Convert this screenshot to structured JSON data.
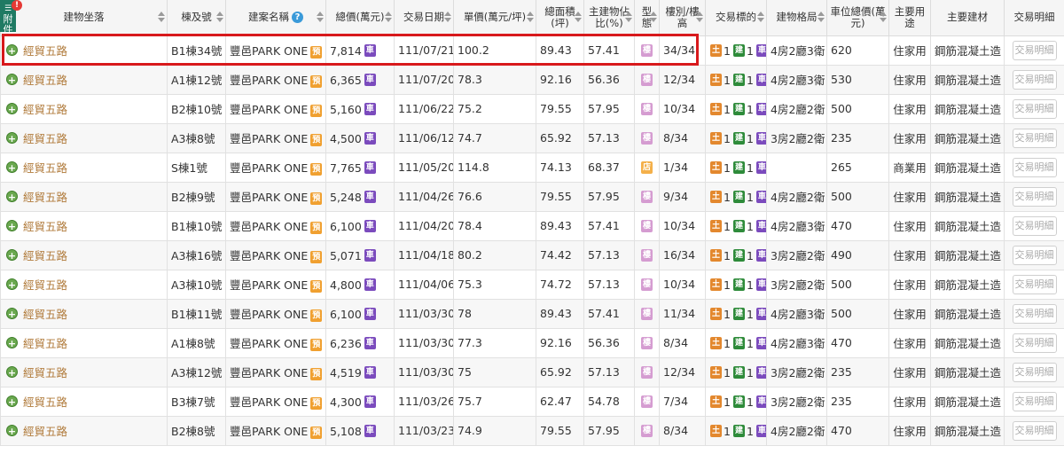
{
  "side_tab": {
    "icon": "☰",
    "label": "附件"
  },
  "alert": "!",
  "headers": [
    "建物坐落",
    "棟及號",
    "建案名稱",
    "總價(萬元)",
    "交易日期",
    "單價(萬元/坪)",
    "總面積(坪)",
    "主建物佔比(%)",
    "型態",
    "樓別/樓高",
    "交易標的",
    "建物格局",
    "車位總價(萬元)",
    "主要用途",
    "主要建材",
    "交易明細"
  ],
  "badges": {
    "pre": "預",
    "car": "車",
    "land": "土",
    "bld": "建",
    "carp": "車",
    "type_res": "樓",
    "type_shop": "店"
  },
  "detail_label": "交易明細",
  "rows": [
    {
      "addr": "經貿五路",
      "unit": "B1棟34號",
      "project": "豐邑PARK ONE",
      "total": "7,814",
      "date": "111/07/21",
      "unit_price": "100.2",
      "area": "89.43",
      "ratio": "57.41",
      "type": "res",
      "floor": "34/34",
      "land": "1",
      "bld": "1",
      "car": "2",
      "layout": "4房2廳3衛",
      "parking": "620",
      "use": "住家用",
      "material": "鋼筋混凝土造"
    },
    {
      "addr": "經貿五路",
      "unit": "A1棟12號",
      "project": "豐邑PARK ONE",
      "total": "6,365",
      "date": "111/07/20",
      "unit_price": "78.3",
      "area": "92.16",
      "ratio": "56.36",
      "type": "res",
      "floor": "12/34",
      "land": "1",
      "bld": "1",
      "car": "2",
      "layout": "4房2廳3衛",
      "parking": "530",
      "use": "住家用",
      "material": "鋼筋混凝土造"
    },
    {
      "addr": "經貿五路",
      "unit": "B2棟10號",
      "project": "豐邑PARK ONE",
      "total": "5,160",
      "date": "111/06/22",
      "unit_price": "75.2",
      "area": "79.55",
      "ratio": "57.95",
      "type": "res",
      "floor": "10/34",
      "land": "1",
      "bld": "1",
      "car": "2",
      "layout": "4房2廳2衛",
      "parking": "500",
      "use": "住家用",
      "material": "鋼筋混凝土造"
    },
    {
      "addr": "經貿五路",
      "unit": "A3棟8號",
      "project": "豐邑PARK ONE",
      "total": "4,500",
      "date": "111/06/12",
      "unit_price": "74.7",
      "area": "65.92",
      "ratio": "57.13",
      "type": "res",
      "floor": "8/34",
      "land": "1",
      "bld": "1",
      "car": "1",
      "layout": "3房2廳2衛",
      "parking": "235",
      "use": "住家用",
      "material": "鋼筋混凝土造"
    },
    {
      "addr": "經貿五路",
      "unit": "S棟1號",
      "project": "豐邑PARK ONE",
      "total": "7,765",
      "date": "111/05/20",
      "unit_price": "114.8",
      "area": "74.13",
      "ratio": "68.37",
      "type": "shop",
      "floor": "1/34",
      "land": "1",
      "bld": "1",
      "car": "1",
      "layout": "",
      "parking": "265",
      "use": "商業用",
      "material": "鋼筋混凝土造"
    },
    {
      "addr": "經貿五路",
      "unit": "B2棟9號",
      "project": "豐邑PARK ONE",
      "total": "5,248",
      "date": "111/04/26",
      "unit_price": "76.6",
      "area": "79.55",
      "ratio": "57.95",
      "type": "res",
      "floor": "9/34",
      "land": "1",
      "bld": "1",
      "car": "2",
      "layout": "4房2廳2衛",
      "parking": "500",
      "use": "住家用",
      "material": "鋼筋混凝土造"
    },
    {
      "addr": "經貿五路",
      "unit": "B1棟10號",
      "project": "豐邑PARK ONE",
      "total": "6,100",
      "date": "111/04/20",
      "unit_price": "78.4",
      "area": "89.43",
      "ratio": "57.41",
      "type": "res",
      "floor": "10/34",
      "land": "1",
      "bld": "1",
      "car": "2",
      "layout": "4房2廳3衛",
      "parking": "470",
      "use": "住家用",
      "material": "鋼筋混凝土造"
    },
    {
      "addr": "經貿五路",
      "unit": "A3棟16號",
      "project": "豐邑PARK ONE",
      "total": "5,071",
      "date": "111/04/18",
      "unit_price": "80.2",
      "area": "74.42",
      "ratio": "57.13",
      "type": "res",
      "floor": "16/34",
      "land": "1",
      "bld": "1",
      "car": "2",
      "layout": "3房2廳2衛",
      "parking": "490",
      "use": "住家用",
      "material": "鋼筋混凝土造"
    },
    {
      "addr": "經貿五路",
      "unit": "A3棟10號",
      "project": "豐邑PARK ONE",
      "total": "4,800",
      "date": "111/04/06",
      "unit_price": "75.3",
      "area": "74.72",
      "ratio": "57.13",
      "type": "res",
      "floor": "10/34",
      "land": "1",
      "bld": "1",
      "car": "2",
      "layout": "3房2廳2衛",
      "parking": "500",
      "use": "住家用",
      "material": "鋼筋混凝土造"
    },
    {
      "addr": "經貿五路",
      "unit": "B1棟11號",
      "project": "豐邑PARK ONE",
      "total": "6,100",
      "date": "111/03/30",
      "unit_price": "78",
      "area": "89.43",
      "ratio": "57.41",
      "type": "res",
      "floor": "11/34",
      "land": "1",
      "bld": "1",
      "car": "2",
      "layout": "4房2廳3衛",
      "parking": "500",
      "use": "住家用",
      "material": "鋼筋混凝土造"
    },
    {
      "addr": "經貿五路",
      "unit": "A1棟8號",
      "project": "豐邑PARK ONE",
      "total": "6,236",
      "date": "111/03/30",
      "unit_price": "77.3",
      "area": "92.16",
      "ratio": "56.36",
      "type": "res",
      "floor": "8/34",
      "land": "1",
      "bld": "1",
      "car": "2",
      "layout": "4房2廳3衛",
      "parking": "470",
      "use": "住家用",
      "material": "鋼筋混凝土造"
    },
    {
      "addr": "經貿五路",
      "unit": "A3棟12號",
      "project": "豐邑PARK ONE",
      "total": "4,519",
      "date": "111/03/30",
      "unit_price": "75",
      "area": "65.92",
      "ratio": "57.13",
      "type": "res",
      "floor": "12/34",
      "land": "1",
      "bld": "1",
      "car": "1",
      "layout": "3房2廳2衛",
      "parking": "235",
      "use": "住家用",
      "material": "鋼筋混凝土造"
    },
    {
      "addr": "經貿五路",
      "unit": "B3棟7號",
      "project": "豐邑PARK ONE",
      "total": "4,300",
      "date": "111/03/26",
      "unit_price": "75.7",
      "area": "62.47",
      "ratio": "54.78",
      "type": "res",
      "floor": "7/34",
      "land": "1",
      "bld": "1",
      "car": "1",
      "layout": "3房2廳2衛",
      "parking": "235",
      "use": "住家用",
      "material": "鋼筋混凝土造"
    },
    {
      "addr": "經貿五路",
      "unit": "B2棟8號",
      "project": "豐邑PARK ONE",
      "total": "5,108",
      "date": "111/03/23",
      "unit_price": "74.9",
      "area": "79.55",
      "ratio": "57.95",
      "type": "res",
      "floor": "8/34",
      "land": "1",
      "bld": "1",
      "car": "2",
      "layout": "4房2廳2衛",
      "parking": "470",
      "use": "住家用",
      "material": "鋼筋混凝土造"
    }
  ]
}
